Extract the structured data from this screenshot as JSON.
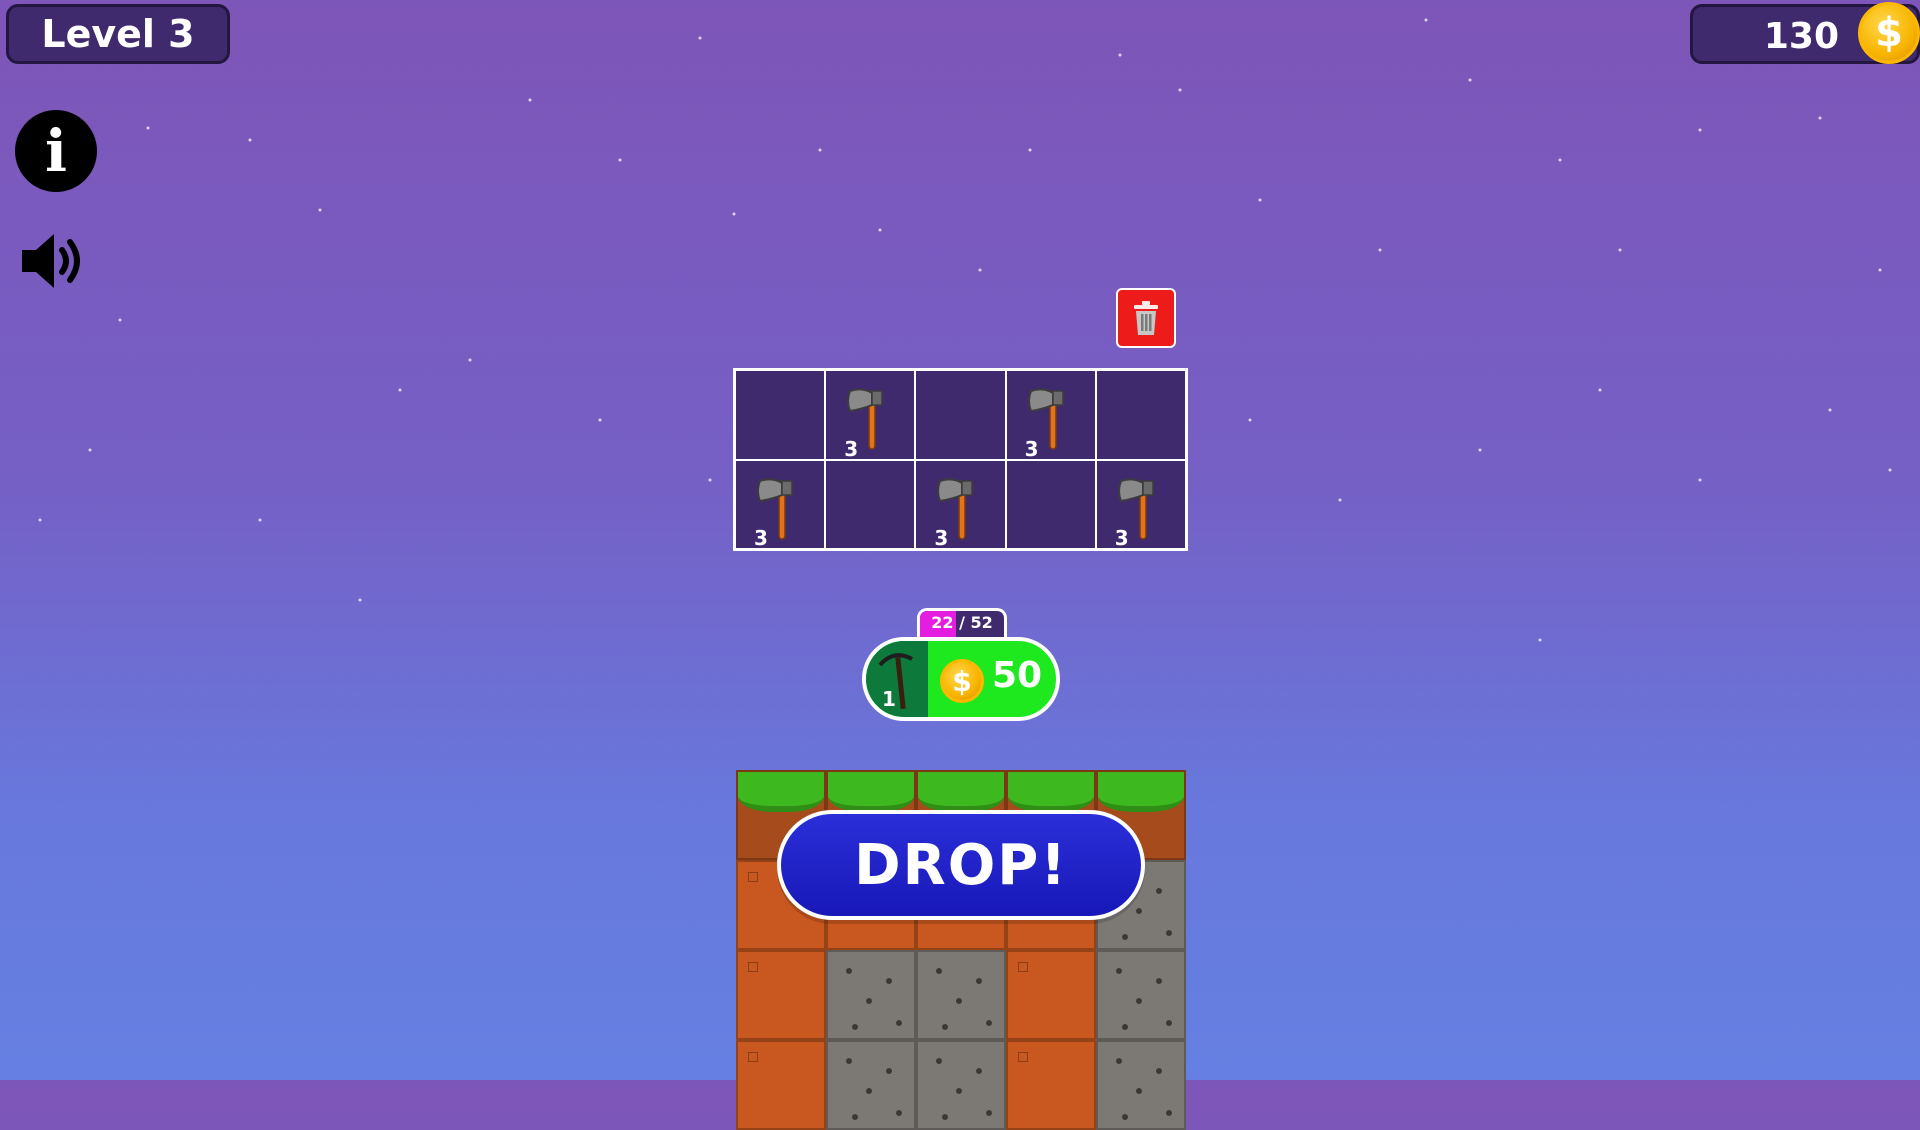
{
  "header": {
    "level_label": "Level 3",
    "coins": "130",
    "coin_symbol": "$"
  },
  "merge_grid": {
    "cells": [
      {
        "item": null,
        "level": ""
      },
      {
        "item": "axe-icon",
        "level": "3"
      },
      {
        "item": null,
        "level": ""
      },
      {
        "item": "axe-icon",
        "level": "3"
      },
      {
        "item": null,
        "level": ""
      },
      {
        "item": "axe-icon",
        "level": "3"
      },
      {
        "item": null,
        "level": ""
      },
      {
        "item": "axe-icon",
        "level": "3"
      },
      {
        "item": null,
        "level": ""
      },
      {
        "item": "axe-icon",
        "level": "3"
      }
    ]
  },
  "progress": {
    "text": "22 / 52",
    "current": 22,
    "total": 52
  },
  "buy": {
    "tool_icon": "pickaxe-icon",
    "tool_level": "1",
    "coin_symbol": "$",
    "price": "50"
  },
  "drop_label": "DROP!",
  "colors": {
    "panel": "#3f2a6e",
    "trash": "#ee1b1b",
    "buy_green": "#1ee81e",
    "drop_blue": "#1f22c8",
    "progress": "#e51de0"
  }
}
